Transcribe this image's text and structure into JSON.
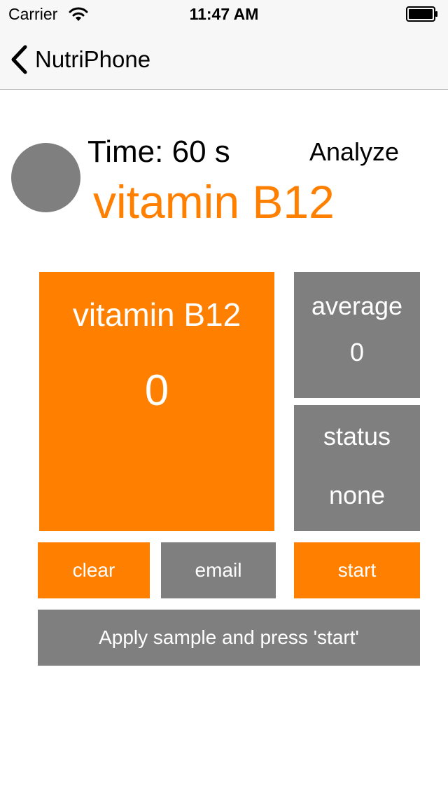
{
  "status_bar": {
    "carrier": "Carrier",
    "time": "11:47 AM",
    "wifi_icon": "wifi-icon",
    "battery_icon": "battery-icon"
  },
  "nav_bar": {
    "back_icon": "chevron-left-icon",
    "back_label": "NutriPhone"
  },
  "header": {
    "time_label": "Time: 60 s",
    "analyze_label": "Analyze",
    "nutrient_title": "vitamin B12"
  },
  "tiles": {
    "main": {
      "label": "vitamin B12",
      "value": "0"
    },
    "average": {
      "label": "average",
      "value": "0"
    },
    "status": {
      "label": "status",
      "value": "none"
    }
  },
  "buttons": {
    "clear": "clear",
    "email": "email",
    "start": "start"
  },
  "message": "Apply sample and press 'start'",
  "colors": {
    "accent": "#ff7f00",
    "neutral": "#7f7f7f",
    "nav_background": "#f7f7f7",
    "page_background": "#ffffff"
  }
}
